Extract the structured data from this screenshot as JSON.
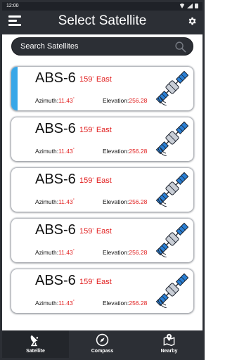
{
  "status": {
    "time": "12:00"
  },
  "header": {
    "title": "Select Satellite"
  },
  "search": {
    "placeholder": "Search Satellites"
  },
  "satellites": [
    {
      "name": "ABS-6",
      "lon_value": "159",
      "lon_deg": "°",
      "lon_dir": "East",
      "azimuth_label": "Azimuth:",
      "azimuth": "11.43",
      "elevation_label": "Elevation:",
      "elevation": "256.28",
      "selected": true
    },
    {
      "name": "ABS-6",
      "lon_value": "159",
      "lon_deg": "°",
      "lon_dir": "East",
      "azimuth_label": "Azimuth:",
      "azimuth": "11.43",
      "elevation_label": "Elevation:",
      "elevation": "256.28",
      "selected": false
    },
    {
      "name": "ABS-6",
      "lon_value": "159",
      "lon_deg": "°",
      "lon_dir": "East",
      "azimuth_label": "Azimuth:",
      "azimuth": "11.43",
      "elevation_label": "Elevation:",
      "elevation": "256.28",
      "selected": false
    },
    {
      "name": "ABS-6",
      "lon_value": "159",
      "lon_deg": "°",
      "lon_dir": "East",
      "azimuth_label": "Azimuth:",
      "azimuth": "11.43",
      "elevation_label": "Elevation:",
      "elevation": "256.28",
      "selected": false
    },
    {
      "name": "ABS-6",
      "lon_value": "159",
      "lon_deg": "°",
      "lon_dir": "East",
      "azimuth_label": "Azimuth:",
      "azimuth": "11.43",
      "elevation_label": "Elevation:",
      "elevation": "256.28",
      "selected": false
    }
  ],
  "tabs": [
    {
      "label": "Satellite",
      "icon": "satellite-dish-icon",
      "active": true
    },
    {
      "label": "Compass",
      "icon": "compass-icon",
      "active": false
    },
    {
      "label": "Nearby",
      "icon": "map-pin-icon",
      "active": false
    }
  ],
  "colors": {
    "bar": "#2c2f35",
    "accent": "#38a7e8",
    "value_red": "#e11d1d"
  }
}
